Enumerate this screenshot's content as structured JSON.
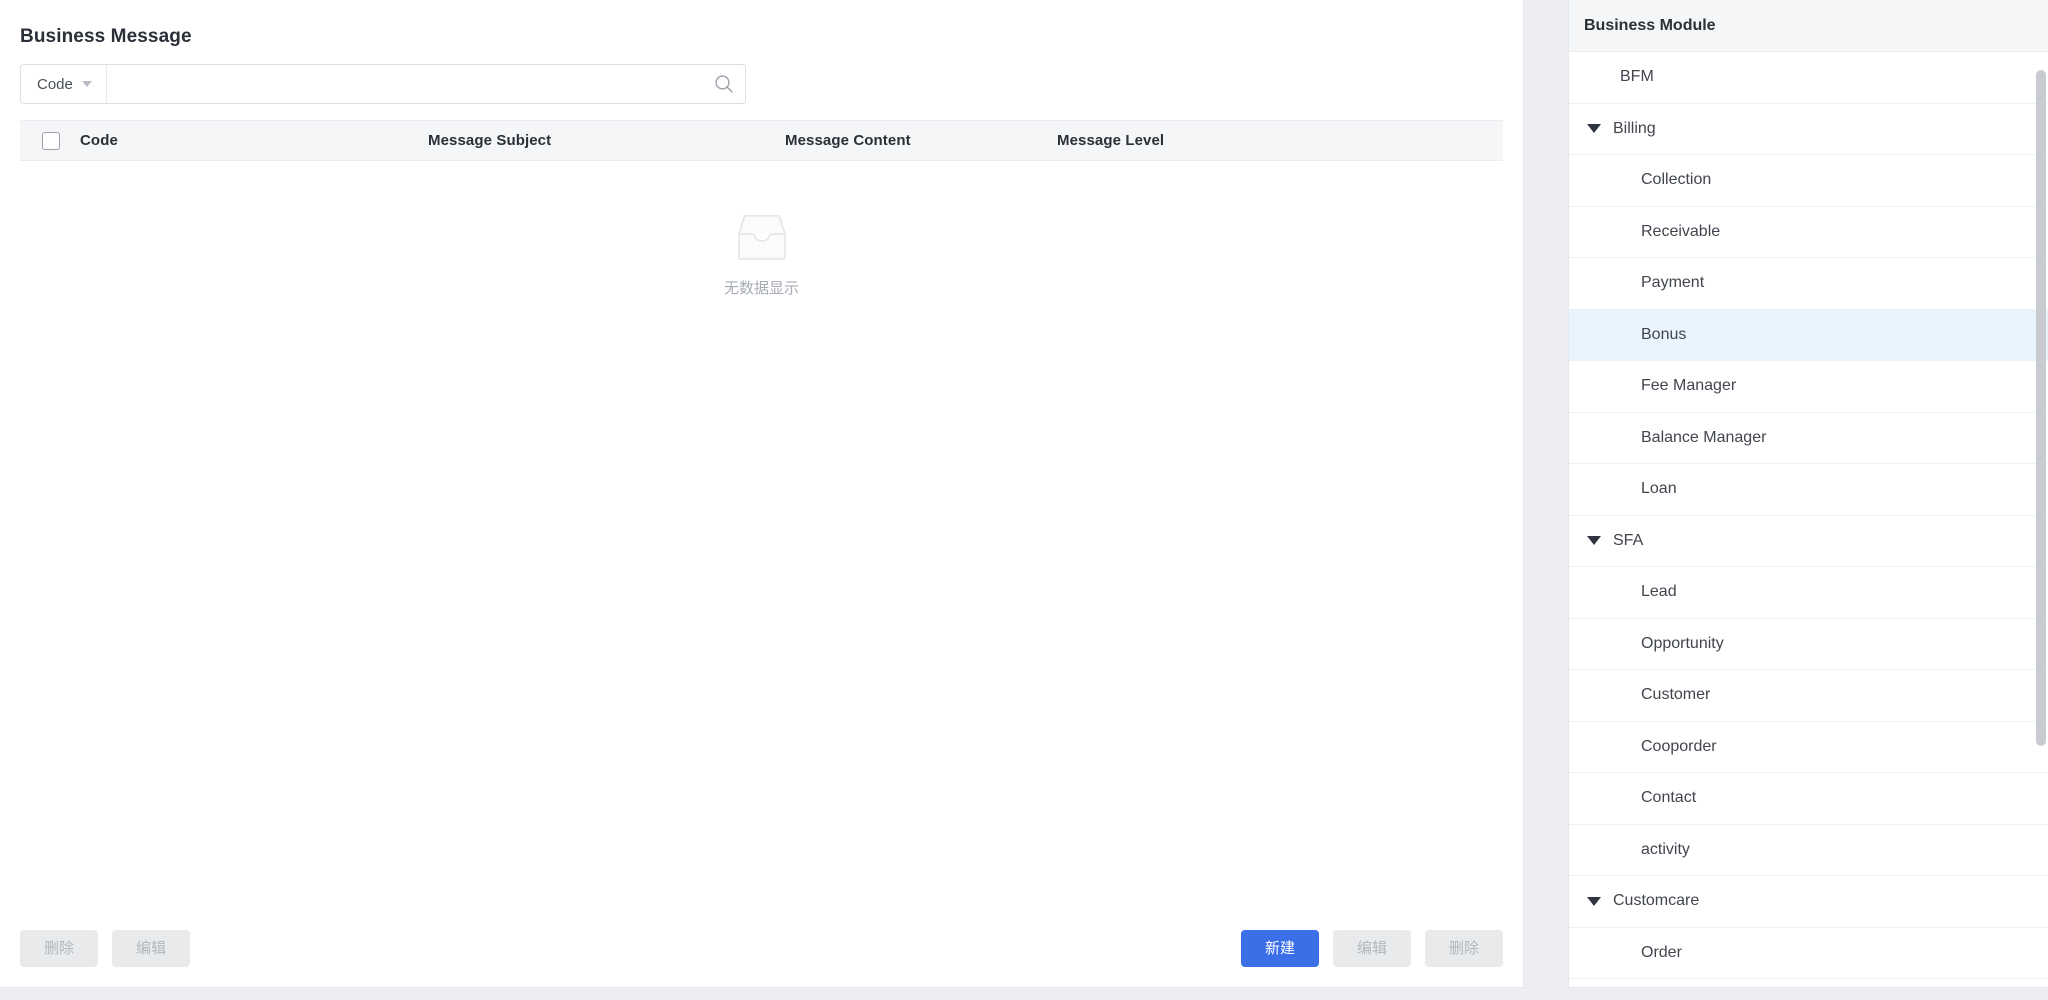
{
  "left_panel": {
    "title": "Business Message",
    "search": {
      "field_selector_label": "Code",
      "input_value": "",
      "input_placeholder": "",
      "search_icon": "search-icon",
      "caret_icon": "chevron-down-icon"
    },
    "table": {
      "columns": [
        "Code",
        "Message Subject",
        "Message Content",
        "Message Level"
      ],
      "select_all_checked": false,
      "rows": [],
      "empty_state": {
        "icon": "empty-inbox-icon",
        "text": "无数据显示"
      }
    },
    "footer": {
      "left_buttons": [
        {
          "label": "删除",
          "state": "disabled",
          "name": "delete-button-left"
        },
        {
          "label": "编辑",
          "state": "disabled",
          "name": "edit-button-left"
        }
      ],
      "right_buttons": [
        {
          "label": "新建",
          "state": "primary",
          "name": "new-button"
        },
        {
          "label": "编辑",
          "state": "disabled",
          "name": "edit-button-right"
        },
        {
          "label": "删除",
          "state": "disabled",
          "name": "delete-button-right"
        }
      ]
    }
  },
  "right_panel": {
    "header_title": "Business Module",
    "selected_item": "Bonus",
    "tree": [
      {
        "label": "BFM",
        "level": "flat",
        "expandable": false,
        "selected": false
      },
      {
        "label": "Billing",
        "level": "parent",
        "expandable": true,
        "selected": false
      },
      {
        "label": "Collection",
        "level": "child",
        "expandable": false,
        "selected": false
      },
      {
        "label": "Receivable",
        "level": "child",
        "expandable": false,
        "selected": false
      },
      {
        "label": "Payment",
        "level": "child",
        "expandable": false,
        "selected": false
      },
      {
        "label": "Bonus",
        "level": "child",
        "expandable": false,
        "selected": true
      },
      {
        "label": "Fee Manager",
        "level": "child",
        "expandable": false,
        "selected": false
      },
      {
        "label": "Balance Manager",
        "level": "child",
        "expandable": false,
        "selected": false
      },
      {
        "label": "Loan",
        "level": "child",
        "expandable": false,
        "selected": false
      },
      {
        "label": "SFA",
        "level": "parent",
        "expandable": true,
        "selected": false
      },
      {
        "label": "Lead",
        "level": "child",
        "expandable": false,
        "selected": false
      },
      {
        "label": "Opportunity",
        "level": "child",
        "expandable": false,
        "selected": false
      },
      {
        "label": "Customer",
        "level": "child",
        "expandable": false,
        "selected": false
      },
      {
        "label": "Cooporder",
        "level": "child",
        "expandable": false,
        "selected": false
      },
      {
        "label": "Contact",
        "level": "child",
        "expandable": false,
        "selected": false
      },
      {
        "label": "activity",
        "level": "child",
        "expandable": false,
        "selected": false
      },
      {
        "label": "Customcare",
        "level": "parent",
        "expandable": true,
        "selected": false
      },
      {
        "label": "Order",
        "level": "child",
        "expandable": false,
        "selected": false
      }
    ],
    "scrollbar": {
      "visible": true
    }
  },
  "colors": {
    "accent": "#3b6fe8",
    "selected_row": "#e9f4fd",
    "header_bg": "#f5f6f8",
    "page_bg": "#eceef1",
    "text_primary": "#2b2f38",
    "disabled_bg": "#e9eaec",
    "disabled_text": "#b3b7bf"
  }
}
